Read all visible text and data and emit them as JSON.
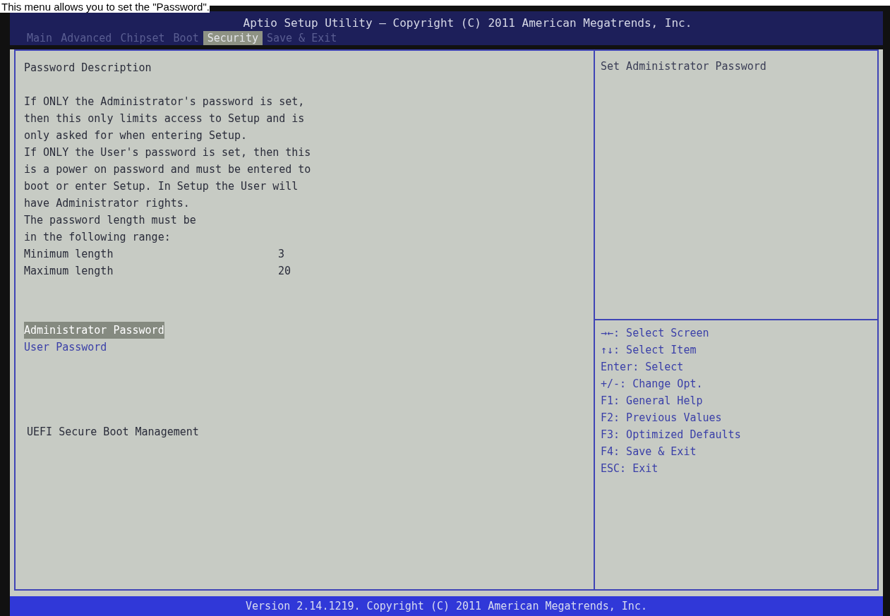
{
  "caption": "This menu allows you to set the \"Password\".",
  "window": {
    "title": "Aptio Setup Utility – Copyright (C) 2011 American Megatrends, Inc."
  },
  "tabs": [
    {
      "label": "Main",
      "selected": false
    },
    {
      "label": "Advanced",
      "selected": false
    },
    {
      "label": "Chipset",
      "selected": false
    },
    {
      "label": "Boot",
      "selected": false
    },
    {
      "label": "Security",
      "selected": true
    },
    {
      "label": "Save & Exit",
      "selected": false
    }
  ],
  "main": {
    "heading": "Password Description",
    "description": [
      "If ONLY the Administrator's password is set,",
      "then this only limits access to Setup and is",
      "only asked for when entering Setup.",
      "If ONLY the User's password is set, then this",
      "is a power on password and must be entered to",
      "boot or enter Setup. In Setup the User will",
      "have Administrator rights.",
      "The password length must be",
      "in the following range:"
    ],
    "settings": [
      {
        "label": "Minimum length",
        "value": "3"
      },
      {
        "label": "Maximum length",
        "value": "20"
      }
    ],
    "items": [
      {
        "label": "Administrator Password",
        "kind": "option",
        "selected": true
      },
      {
        "label": "User Password",
        "kind": "option",
        "selected": false
      },
      {
        "label": "UEFI Secure Boot Management",
        "kind": "submenu",
        "selected": false
      }
    ]
  },
  "help": {
    "text": "Set Administrator Password",
    "keys": [
      "→←: Select Screen",
      "↑↓: Select Item",
      "Enter: Select",
      "+/-: Change Opt.",
      "F1: General Help",
      "F2: Previous Values",
      "F3: Optimized Defaults",
      "F4: Save & Exit",
      "ESC: Exit"
    ]
  },
  "status_bar": "Version 2.14.1219. Copyright (C) 2011 American Megatrends, Inc."
}
